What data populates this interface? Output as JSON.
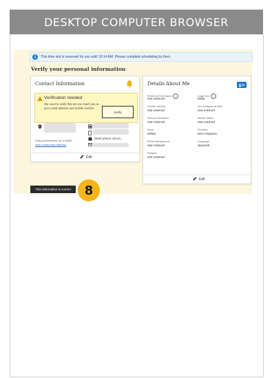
{
  "banner": {
    "title": "DESKTOP COMPUTER BROWSER"
  },
  "alert": {
    "message": "This time slot is reserved for you until 10:14 AM. Please complete scheduling by then."
  },
  "page": {
    "heading": "Verify your personal information"
  },
  "contact": {
    "title": "Contact Information",
    "verification": {
      "title": "Verification needed",
      "message": "We need to verify that we can reach you at your email address and mobile number.",
      "button": "Verify"
    },
    "temp_prompt": "Going somewhere for a while?",
    "temp_link": "Add a temporary address",
    "work_phone": "Work phone not en...",
    "edit_label": "Edit"
  },
  "details": {
    "title": "Details About Me",
    "fields": [
      {
        "label": "Preferred First Name",
        "value": "Not entered",
        "italic": true
      },
      {
        "label": "Legal Sex",
        "value": "Male",
        "italic": false
      },
      {
        "label": "Gender Identity",
        "value": "Not entered",
        "italic": true
      },
      {
        "label": "Sex Assigned at Birth",
        "value": "Not entered",
        "italic": true
      },
      {
        "label": "Sexual Orientation",
        "value": "Not entered",
        "italic": true
      },
      {
        "label": "Marital Status",
        "value": "Not entered",
        "italic": true
      },
      {
        "label": "Race",
        "value": "White",
        "italic": false
      },
      {
        "label": "Ethnicity",
        "value": "Non-Hispanic",
        "italic": false
      },
      {
        "label": "Ethnic Background",
        "value": "Not entered",
        "italic": true
      },
      {
        "label": "Language",
        "value": "Spanish",
        "italic": false
      },
      {
        "label": "Religion",
        "value": "Not entered",
        "italic": true
      }
    ],
    "edit_label": "Edit"
  },
  "footer": {
    "confirm_button": "This information is correct"
  },
  "step_badge": {
    "number": "8"
  }
}
